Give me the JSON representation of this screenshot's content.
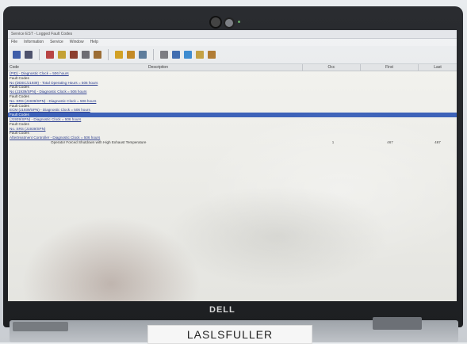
{
  "window": {
    "title": "Service EST - Logged Fault Codes",
    "menu": [
      "File",
      "Information",
      "Service",
      "Window",
      "Help"
    ]
  },
  "toolbar": {
    "icons": [
      "save-icon",
      "print-icon",
      "graph-icon",
      "flash-icon",
      "tools-icon",
      "engine-icon",
      "gauge-icon",
      "folder-icon",
      "refresh-icon",
      "document-icon",
      "settings-icon",
      "home-icon",
      "download-icon",
      "export-icon",
      "report-icon"
    ]
  },
  "grid": {
    "headers": {
      "code": "Code",
      "description": "Description",
      "occ": "Occ",
      "first": "First",
      "last": "Last"
    },
    "rows": [
      {
        "text": "(PID) - Diagnostic Clock = 506 hours",
        "style": "link"
      },
      {
        "text": "Fault Codes",
        "style": "plain"
      },
      {
        "text": "No (DDEC/J1939) - Total Operating Hours = 506 hours",
        "style": "link"
      },
      {
        "text": "Fault Codes",
        "style": "plain"
      },
      {
        "text": "No (J1939/SPN) - Diagnostic Clock = 506 hours",
        "style": "link"
      },
      {
        "text": "Fault Codes",
        "style": "plain"
      },
      {
        "text": "No. SRS (J1939/SPN) - Diagnostic Clock = 506 hours",
        "style": "link"
      },
      {
        "text": "Fault Codes",
        "style": "plain"
      },
      {
        "text": "ECM (J1939/SPN) - Diagnostic Clock = 506 hours",
        "style": "link"
      },
      {
        "text": "Fault Codes",
        "style": "selected"
      },
      {
        "text": "(J1939/SPN) - Diagnostic Clock = 506 hours",
        "style": "link"
      },
      {
        "text": "Fault Codes",
        "style": "plain"
      },
      {
        "text": "No. SRS (J1939/SPN)",
        "style": "link"
      },
      {
        "text": "Fault Codes",
        "style": "plain"
      },
      {
        "text": "Aftertreatment Controller - Diagnostic Clock = 506 hours",
        "style": "link"
      },
      {
        "text": "Operator Forced Shutdown with High Exhaust Temperature",
        "style": "indent",
        "occ": "1",
        "first": "467",
        "last": "467"
      }
    ]
  },
  "hardware": {
    "brand": "DELL",
    "asset_label": "LASLSFULLER"
  }
}
